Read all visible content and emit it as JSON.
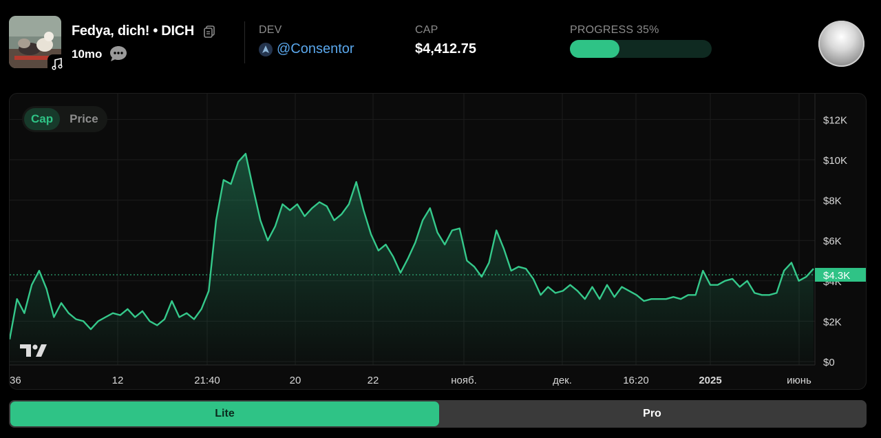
{
  "token": {
    "name": "Fedya, dich! • DICH",
    "age": "10mo",
    "image": "token-image",
    "music_icon": "music-note-icon",
    "copy_icon": "copy-icon",
    "chat_icon": "speech-bubble-icon"
  },
  "dev": {
    "label": "DEV",
    "handle": "@Consentor",
    "avatar_icon": "dev-avatar-icon"
  },
  "cap": {
    "label": "CAP",
    "value": "$4,412.75"
  },
  "progress": {
    "label": "PROGRESS 35%",
    "percent": 35
  },
  "colors": {
    "accent": "#2fc386",
    "link": "#5aa7ec",
    "background": "#000000"
  },
  "chart_toggle": {
    "options": [
      "Cap",
      "Price"
    ],
    "selected": "Cap"
  },
  "chart_data": {
    "type": "area",
    "title": "",
    "xlabel": "",
    "ylabel": "",
    "x_ticks": [
      "36",
      "12",
      "21:40",
      "20",
      "22",
      "нояб.",
      "дек.",
      "16:20",
      "2025",
      "июнь"
    ],
    "y_ticks": [
      "$12K",
      "$10K",
      "$8K",
      "$6K",
      "$4K",
      "$2K",
      "$0"
    ],
    "ylim": [
      0,
      12800
    ],
    "current_value_label": "$4.3K",
    "current_value": 4300,
    "grid": true,
    "series": [
      {
        "values": [
          1100,
          3100,
          2400,
          3800,
          4500,
          3600,
          2200,
          2900,
          2400,
          2100,
          2000,
          1600,
          2000,
          2200,
          2400,
          2300,
          2600,
          2200,
          2500,
          2000,
          1800,
          2100,
          3000,
          2200,
          2400,
          2100,
          2600,
          3500,
          7000,
          9000,
          8800,
          9900,
          10300,
          8600,
          7000,
          6000,
          6700,
          7800,
          7500,
          7800,
          7200,
          7600,
          7900,
          7700,
          7000,
          7300,
          7800,
          8900,
          7500,
          6300,
          5500,
          5800,
          5200,
          4400,
          5100,
          5900,
          7000,
          7600,
          6400,
          5800,
          6500,
          6600,
          5000,
          4700,
          4200,
          4900,
          6500,
          5600,
          4500,
          4700,
          4600,
          4100,
          3300,
          3700,
          3400,
          3500,
          3800,
          3500,
          3100,
          3700,
          3100,
          3800,
          3200,
          3700,
          3500,
          3300,
          3000,
          3100,
          3100,
          3100,
          3200,
          3100,
          3300,
          3300,
          4500,
          3800,
          3800,
          4000,
          4100,
          3700,
          4000,
          3400,
          3300,
          3300,
          3400,
          4500,
          4900,
          4000,
          4200,
          4600
        ]
      }
    ]
  },
  "tradingview_logo": "tradingview-logo-icon",
  "orb_icon": "orb-button-icon",
  "modes": {
    "lite": "Lite",
    "pro": "Pro",
    "selected": "Lite"
  }
}
